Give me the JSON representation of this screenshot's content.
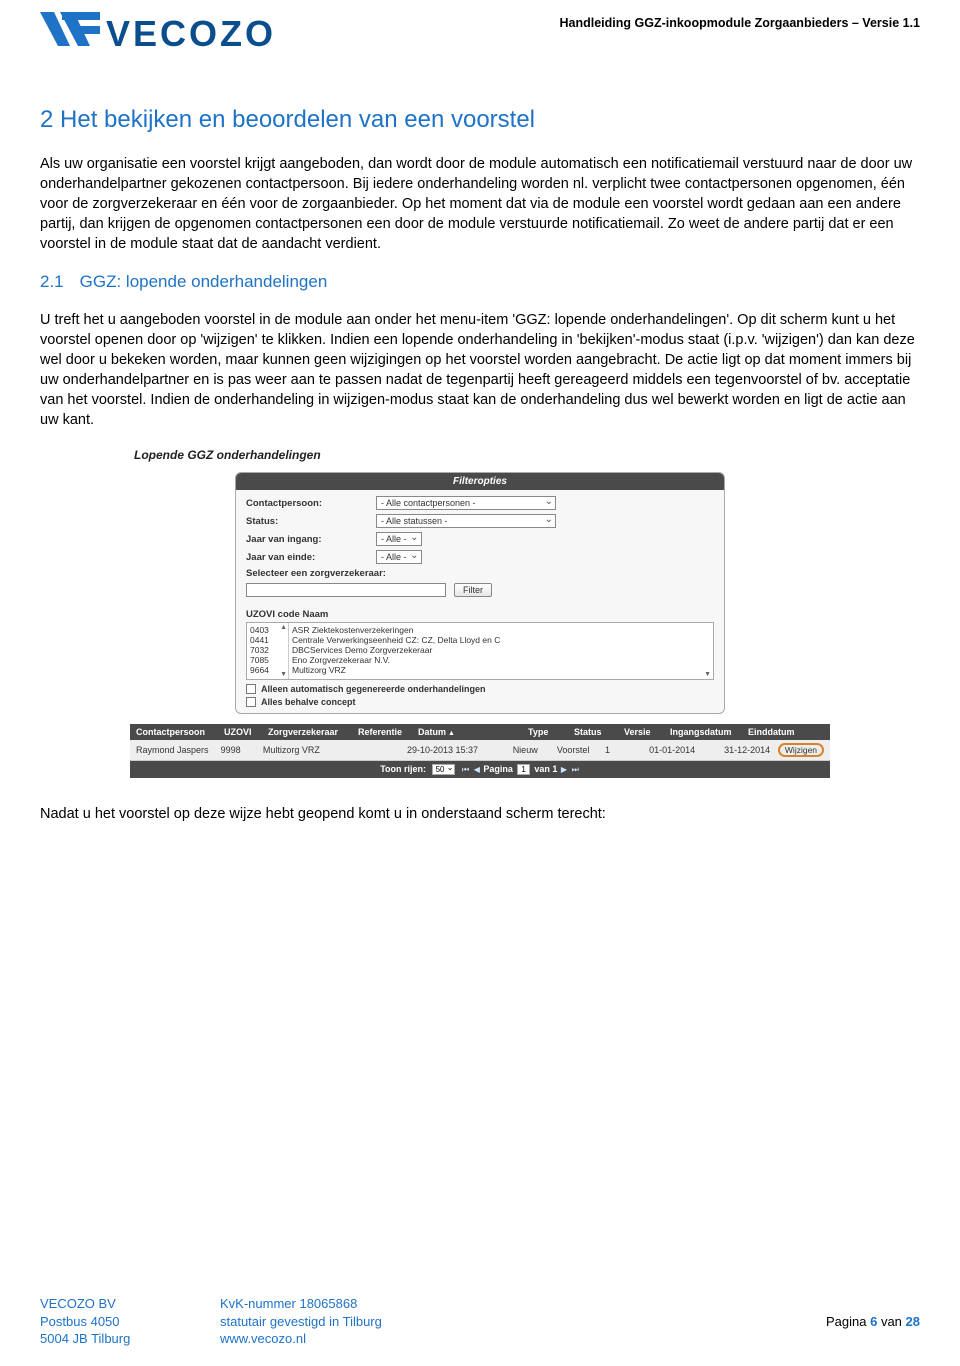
{
  "header": {
    "logo_text": "VECOZO",
    "doc_title": "Handleiding GGZ-inkoopmodule Zorgaanbieders – Versie 1.1"
  },
  "section": {
    "number": "2",
    "title": "Het bekijken en beoordelen van een voorstel"
  },
  "para1": "Als uw organisatie een voorstel krijgt aangeboden, dan wordt door de module automatisch een notificatiemail verstuurd naar de door uw onderhandelpartner gekozenen contactpersoon. Bij iedere onderhandeling worden nl. verplicht twee contactpersonen opgenomen, één voor de zorgverzekeraar en één voor de zorgaanbieder. Op het moment dat via de module een voorstel wordt gedaan aan een andere partij, dan krijgen de opgenomen contactpersonen een door de module verstuurde notificatiemail. Zo weet de andere partij dat er een voorstel in de module staat dat de aandacht verdient.",
  "subsection": {
    "number": "2.1",
    "title": "GGZ: lopende onderhandelingen"
  },
  "para2": "U treft het u aangeboden voorstel in de module aan onder het menu-item 'GGZ: lopende onderhandelingen'. Op dit scherm kunt u het voorstel openen door op 'wijzigen' te klikken. Indien een lopende onderhandeling in 'bekijken'-modus staat  (i.p.v. 'wijzigen') dan kan deze wel door u bekeken worden, maar kunnen geen wijzigingen op het voorstel worden aangebracht. De actie ligt op dat moment immers bij uw onderhandelpartner en is pas weer aan te passen nadat de tegenpartij heeft gereageerd middels een tegenvoorstel of bv. acceptatie van het voorstel. Indien de onderhandeling in wijzigen-modus staat kan de onderhandeling dus wel bewerkt worden en ligt de actie aan uw kant.",
  "screenshot": {
    "title": "Lopende GGZ onderhandelingen",
    "panel_head": "Filteropties",
    "labels": {
      "contactpersoon": "Contactpersoon:",
      "status": "Status:",
      "jaar_ingang": "Jaar van ingang:",
      "jaar_einde": "Jaar van einde:",
      "select_zv": "Selecteer een zorgverzekeraar:",
      "uzovi_naam": "UZOVI code Naam"
    },
    "selects": {
      "contactpersoon": "- Alle contactpersonen -",
      "status": "- Alle statussen -",
      "jaar_ingang": "- Alle -",
      "jaar_einde": "- Alle -"
    },
    "filter_button": "Filter",
    "zv_list": {
      "codes": [
        "0403",
        "0441",
        "7032",
        "7085",
        "9664"
      ],
      "names": [
        "ASR Ziektekostenverzekeringen",
        "Centrale Verwerkingseenheid CZ: CZ, Delta Lloyd en C",
        "DBCServices Demo Zorgverzekeraar",
        "Eno Zorgverzekeraar N.V.",
        "Multizorg VRZ"
      ]
    },
    "checkboxes": {
      "auto": "Alleen automatisch gegenereerde onderhandelingen",
      "concept": "Alles behalve concept"
    },
    "columns": {
      "contact": "Contactpersoon",
      "uzovi": "UZOVI",
      "zv": "Zorgverzekeraar",
      "ref": "Referentie",
      "date": "Datum",
      "type": "Type",
      "status": "Status",
      "versie": "Versie",
      "ingang": "Ingangsdatum",
      "eind": "Einddatum"
    },
    "row": {
      "contact": "Raymond Jaspers",
      "uzovi": "9998",
      "zv": "Multizorg VRZ",
      "ref": "",
      "date": "29-10-2013 15:37",
      "type": "Nieuw",
      "status": "Voorstel",
      "versie": "1",
      "ingang": "01-01-2014",
      "eind": "31-12-2014",
      "action": "Wijzigen"
    },
    "pager": {
      "toon": "Toon rijen:",
      "toon_val": "50",
      "pagina": "Pagina",
      "pg_val": "1",
      "van": "van 1"
    }
  },
  "para3": "Nadat u het voorstel op deze wijze hebt geopend komt u in onderstaand scherm terecht:",
  "footer": {
    "org": "VECOZO BV",
    "postbus": "Postbus 4050",
    "postcode": "5004 JB  Tilburg",
    "kvk": "KvK-nummer 18065868",
    "stat": "statutair gevestigd in Tilburg",
    "site": "www.vecozo.nl",
    "page_prefix": "Pagina ",
    "page_num": "6",
    "page_mid": " van ",
    "page_total": "28"
  }
}
